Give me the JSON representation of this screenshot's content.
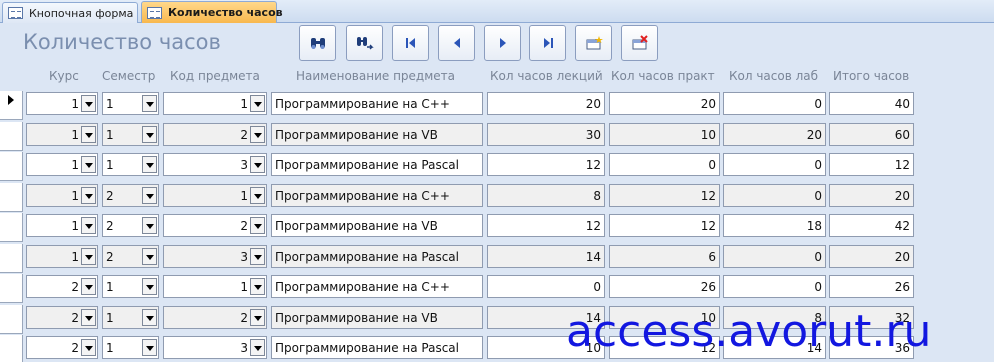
{
  "tabs": [
    {
      "label": "Кнопочная форма",
      "active": false
    },
    {
      "label": "Количество часов",
      "active": true
    }
  ],
  "form": {
    "title": "Количество часов",
    "toolbar": [
      {
        "name": "find-button",
        "icon": "binoculars-icon"
      },
      {
        "name": "find-next-button",
        "icon": "find-next-icon"
      },
      {
        "name": "first-record-button",
        "icon": "first-record-icon"
      },
      {
        "name": "previous-record-button",
        "icon": "previous-record-icon"
      },
      {
        "name": "next-record-button",
        "icon": "next-record-icon"
      },
      {
        "name": "last-record-button",
        "icon": "last-record-icon"
      },
      {
        "name": "new-record-button",
        "icon": "new-record-icon"
      },
      {
        "name": "delete-record-button",
        "icon": "delete-record-icon"
      }
    ]
  },
  "columns": [
    "Курс",
    "Семестр",
    "Код предмета",
    "Наименование предмета",
    "Кол часов лекций",
    "Кол часов практ",
    "Кол часов лаб",
    "Итого часов"
  ],
  "rows": [
    {
      "course": "1",
      "semester": "1",
      "code": "1",
      "name": "Программирование на С++",
      "lectures": "20",
      "practice": "20",
      "labs": "0",
      "total": "40"
    },
    {
      "course": "1",
      "semester": "1",
      "code": "2",
      "name": "Программирование на VB",
      "lectures": "30",
      "practice": "10",
      "labs": "20",
      "total": "60"
    },
    {
      "course": "1",
      "semester": "1",
      "code": "3",
      "name": "Программирование на Pascal",
      "lectures": "12",
      "practice": "0",
      "labs": "0",
      "total": "12"
    },
    {
      "course": "1",
      "semester": "2",
      "code": "1",
      "name": "Программирование на С++",
      "lectures": "8",
      "practice": "12",
      "labs": "0",
      "total": "20"
    },
    {
      "course": "1",
      "semester": "2",
      "code": "2",
      "name": "Программирование на VB",
      "lectures": "12",
      "practice": "12",
      "labs": "18",
      "total": "42"
    },
    {
      "course": "1",
      "semester": "2",
      "code": "3",
      "name": "Программирование на Pascal",
      "lectures": "14",
      "practice": "6",
      "labs": "0",
      "total": "20"
    },
    {
      "course": "2",
      "semester": "1",
      "code": "1",
      "name": "Программирование на С++",
      "lectures": "0",
      "practice": "26",
      "labs": "0",
      "total": "26"
    },
    {
      "course": "2",
      "semester": "1",
      "code": "2",
      "name": "Программирование на VB",
      "lectures": "14",
      "practice": "10",
      "labs": "8",
      "total": "32"
    },
    {
      "course": "2",
      "semester": "1",
      "code": "3",
      "name": "Программирование на Pascal",
      "lectures": "10",
      "practice": "12",
      "labs": "14",
      "total": "36"
    }
  ],
  "watermark": "access.avorut.ru",
  "colors": {
    "accent_tab": "#f8b84e",
    "title": "#7b8faf",
    "watermark": "#1217e0",
    "background": "#dce6f4"
  }
}
